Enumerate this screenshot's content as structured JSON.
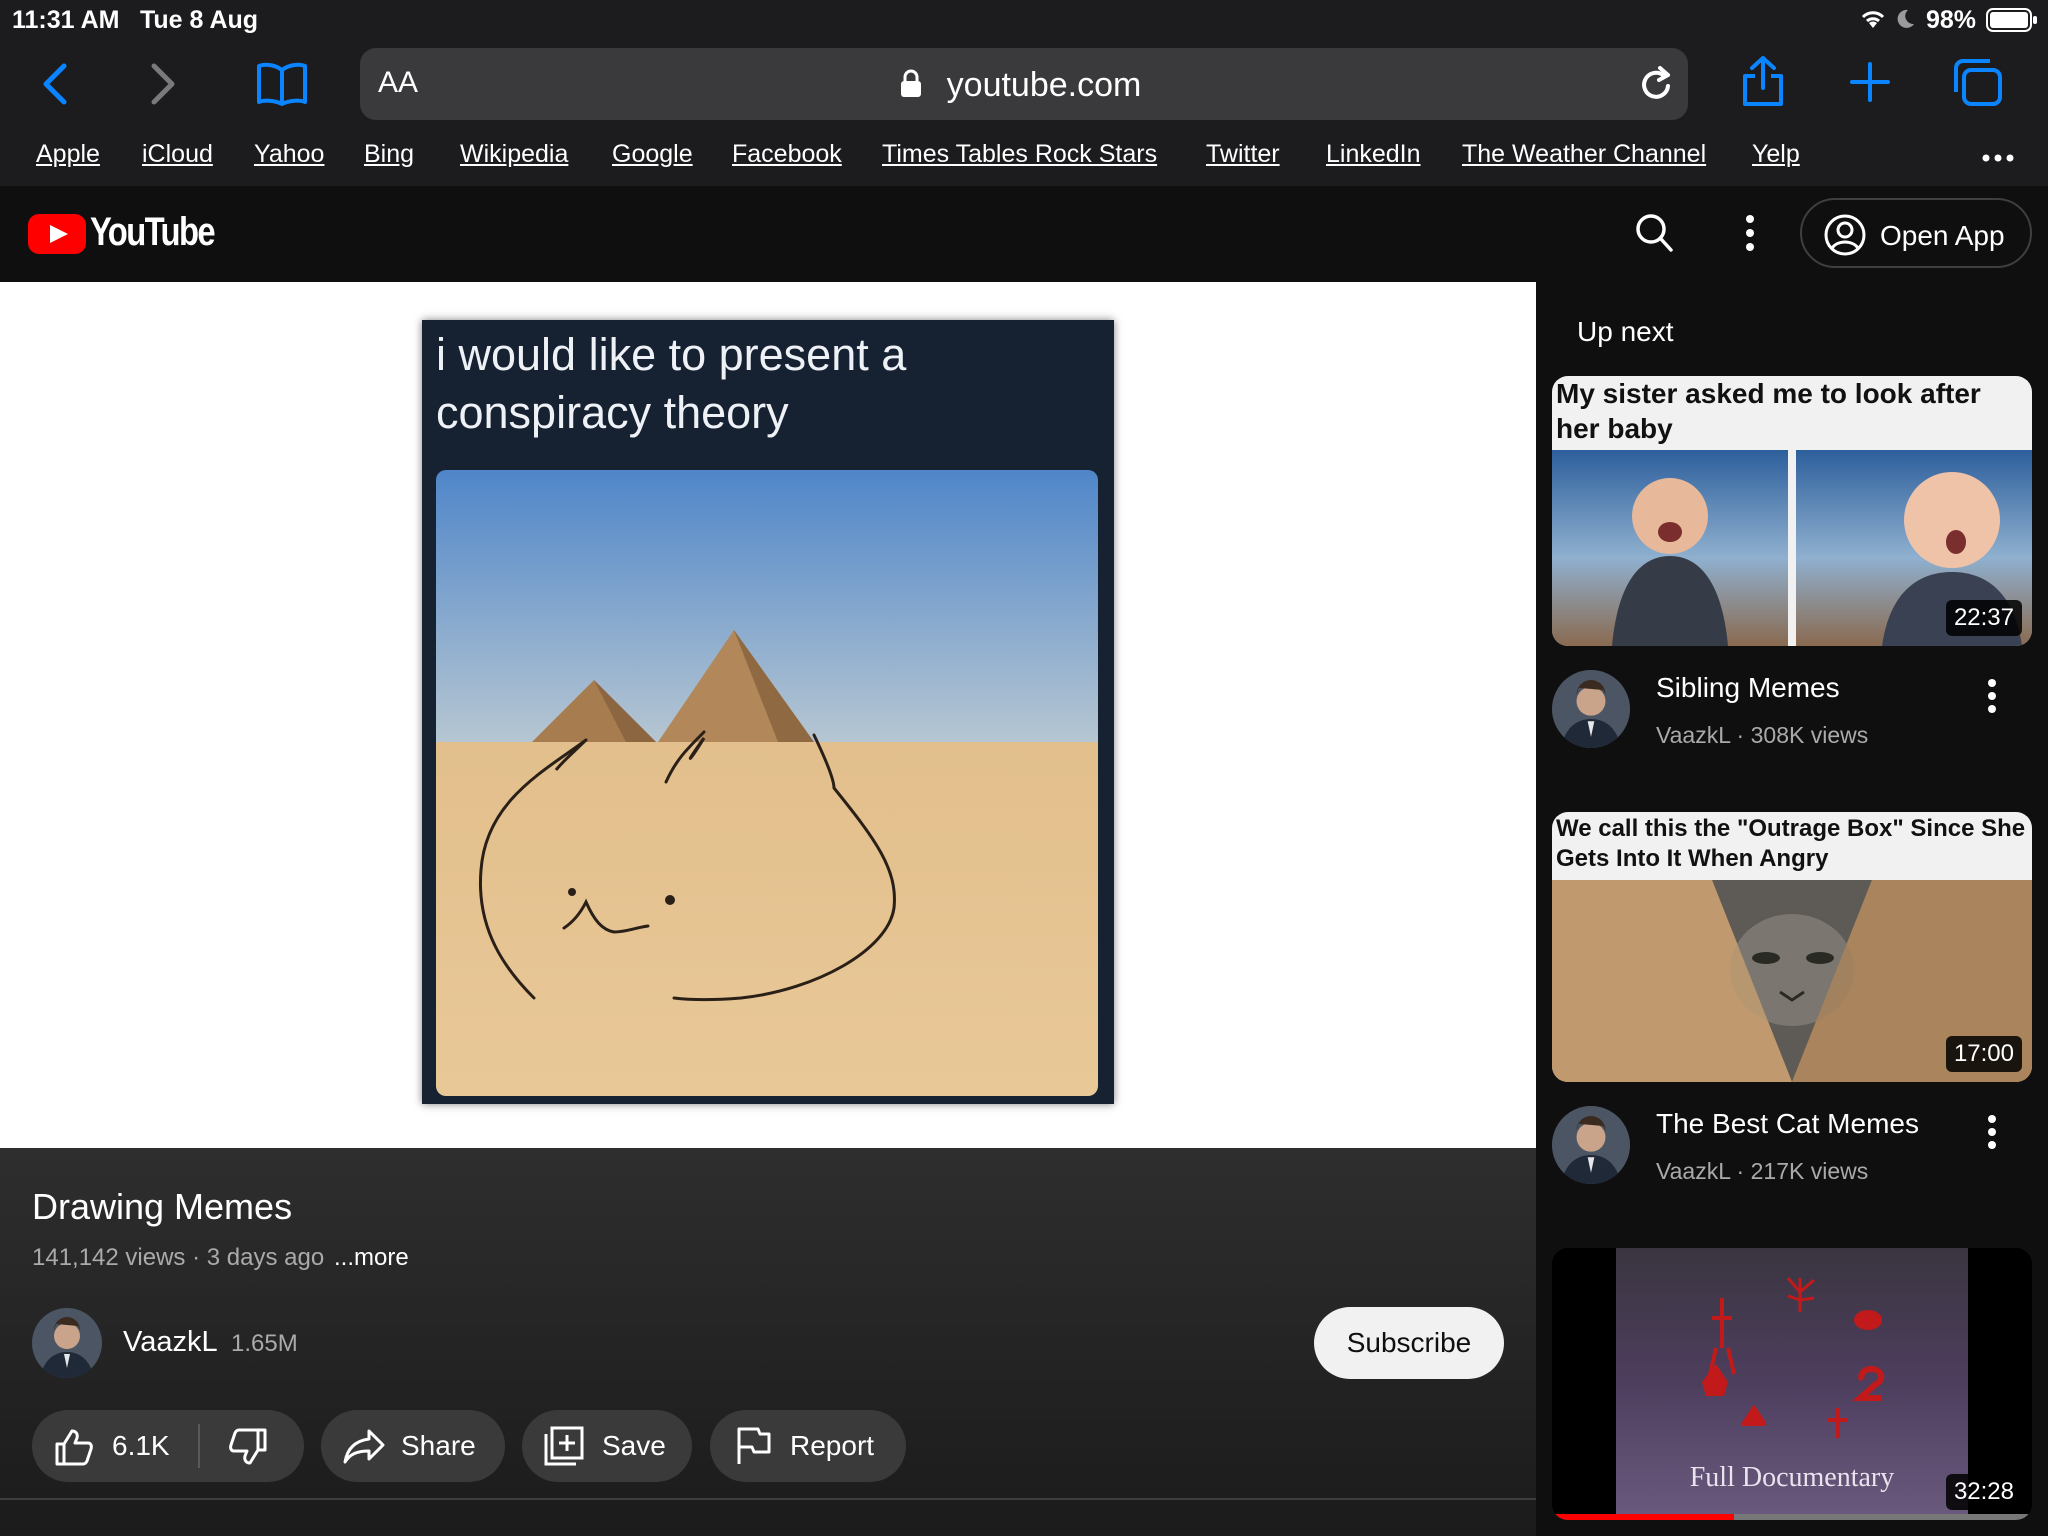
{
  "status": {
    "time": "11:31 AM",
    "date": "Tue 8 Aug",
    "battery": "98%"
  },
  "browser": {
    "aa_label": "AA",
    "url": "youtube.com",
    "bookmarks": [
      "Apple",
      "iCloud",
      "Yahoo",
      "Bing",
      "Wikipedia",
      "Google",
      "Facebook",
      "Times Tables Rock Stars",
      "Twitter",
      "LinkedIn",
      "The Weather Channel",
      "Yelp"
    ]
  },
  "youtube_header": {
    "logo_text": "YouTube",
    "open_app_label": "Open App"
  },
  "player": {
    "meme_caption": "i would like to present a conspiracy theory"
  },
  "video": {
    "title": "Drawing Memes",
    "meta": "141,142 views · 3 days ago",
    "more_label": "...more",
    "channel": "VaazkL",
    "subscribers": "1.65M",
    "subscribe_label": "Subscribe",
    "likes": "6.1K",
    "share_label": "Share",
    "save_label": "Save",
    "report_label": "Report"
  },
  "sidebar": {
    "heading": "Up next",
    "items": [
      {
        "thumb_caption": "My sister asked me to look after her baby",
        "duration": "22:37",
        "title": "Sibling Memes",
        "channel": "VaazkL",
        "views": "308K views"
      },
      {
        "thumb_caption": "We call this the \"Outrage Box\" Since She Gets Into It When Angry",
        "duration": "17:00",
        "title": "The Best Cat Memes",
        "channel": "VaazkL",
        "views": "217K views"
      },
      {
        "thumb_caption": "Full Documentary",
        "duration": "32:28",
        "progress": 0.38
      }
    ]
  },
  "colors": {
    "safari_blue": "#0a84ff",
    "youtube_red": "#ff0000",
    "background": "#0f0f0f"
  }
}
